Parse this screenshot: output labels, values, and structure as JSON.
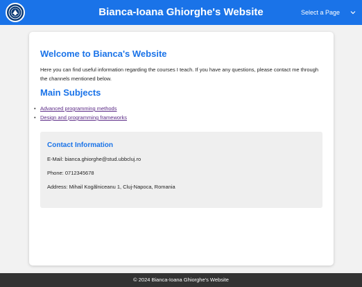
{
  "header": {
    "site_title": "Bianca-Ioana Ghiorghe's Website",
    "select_label": "Select a Page",
    "logo_icon": "university-seal-icon",
    "dropdown_icon": "chevron-down-icon"
  },
  "main": {
    "welcome_heading": "Welcome to Bianca's Website",
    "intro": "Here you can find useful information regarding the courses I teach. If you have any questions, please contact me through the channels mentioned below.",
    "subjects_heading": "Main Subjects",
    "subjects": [
      "Advanced programming methods",
      "Design and programming frameworks"
    ]
  },
  "contact": {
    "heading": "Contact Information",
    "email": "E-Mail: bianca.ghiorghe@stud.ubbcluj.ro",
    "phone": "Phone: 0712345678",
    "address": "Address: Mihail Kogălniceanu 1, Cluj-Napoca, Romania"
  },
  "footer": {
    "text": "© 2024 Bianca-Ioana Ghiorghe's Website"
  },
  "colors": {
    "header_bg": "#1a73e8",
    "heading": "#1a73e8",
    "link": "#5b2a86",
    "footer_bg": "#333333"
  }
}
